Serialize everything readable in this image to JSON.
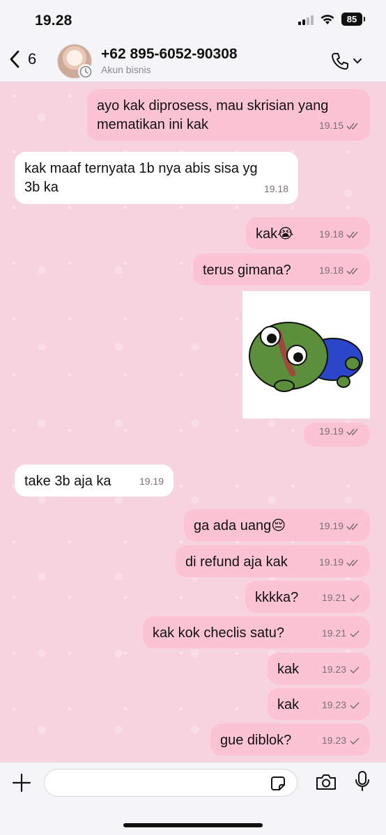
{
  "status_bar": {
    "time": "19.28",
    "battery": "85"
  },
  "header": {
    "back_count": "6",
    "contact_name": "+62 895-6052-90308",
    "contact_subtitle": "Akun bisnis"
  },
  "messages": [
    {
      "direction": "outgoing",
      "text_lines": [
        "ayo kak diprosess, mau skrisian yang",
        "mematikan ini kak"
      ],
      "time": "19.15",
      "status": "read"
    },
    {
      "direction": "incoming",
      "text_lines": [
        "kak maaf ternyata 1b nya abis sisa yg",
        "3b ka"
      ],
      "time": "19.18"
    },
    {
      "direction": "outgoing",
      "text_lines": [
        "kak😭"
      ],
      "time": "19.18",
      "status": "read"
    },
    {
      "direction": "outgoing",
      "text_lines": [
        "terus gimana?"
      ],
      "time": "19.18",
      "status": "read"
    },
    {
      "direction": "outgoing",
      "type": "sticker",
      "sticker": "pepe-frog-lying-sticker",
      "time": "19.19",
      "status": "read"
    },
    {
      "direction": "incoming",
      "text_lines": [
        "take 3b aja ka"
      ],
      "time": "19.19"
    },
    {
      "direction": "outgoing",
      "text_lines": [
        "ga ada uang😔"
      ],
      "time": "19.19",
      "status": "read"
    },
    {
      "direction": "outgoing",
      "text_lines": [
        "di refund aja kak"
      ],
      "time": "19.19",
      "status": "read"
    },
    {
      "direction": "outgoing",
      "text_lines": [
        "kkkka?"
      ],
      "time": "19.21",
      "status": "sent"
    },
    {
      "direction": "outgoing",
      "text_lines": [
        "kak kok checlis satu?"
      ],
      "time": "19.21",
      "status": "sent"
    },
    {
      "direction": "outgoing",
      "text_lines": [
        "kak"
      ],
      "time": "19.23",
      "status": "sent"
    },
    {
      "direction": "outgoing",
      "text_lines": [
        "kak"
      ],
      "time": "19.23",
      "status": "sent"
    },
    {
      "direction": "outgoing",
      "text_lines": [
        "gue diblok?"
      ],
      "time": "19.23",
      "status": "sent"
    }
  ],
  "input_bar": {
    "placeholder": ""
  },
  "colors": {
    "chat_background": "#f7d3e0",
    "outgoing_bubble": "#fbc3d4",
    "incoming_bubble": "#ffffff",
    "tick_color": "#7b6e74"
  },
  "icons": {
    "back": "chevron-left-icon",
    "call": "phone-icon",
    "attach": "plus-icon",
    "sticker": "sticker-icon",
    "camera": "camera-icon",
    "mic": "microphone-icon"
  }
}
